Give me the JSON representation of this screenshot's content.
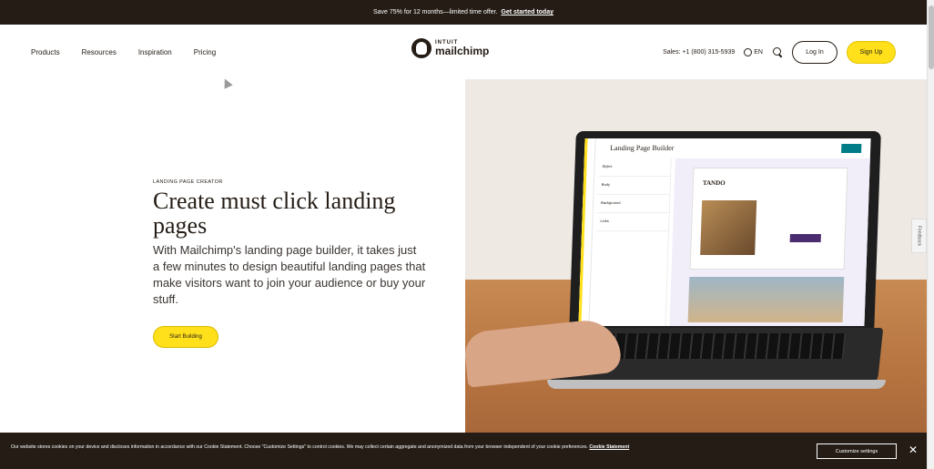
{
  "promo": {
    "text": "Save 75% for 12 months—limited time offer.",
    "link": "Get started today"
  },
  "nav": {
    "items": [
      "Products",
      "Resources",
      "Inspiration",
      "Pricing"
    ],
    "logo_top": "INTUIT",
    "logo_bottom": "mailchimp",
    "sales": "Sales: +1 (800) 315-5939",
    "locale": "EN",
    "login": "Log In",
    "signup": "Sign Up"
  },
  "hero": {
    "eyebrow": "LANDING PAGE CREATOR",
    "title": "Create must click landing pages",
    "body": "With Mailchimp's landing page builder, it takes just a few minutes to design beautiful landing pages that make visitors want to join your audience or buy your stuff.",
    "cta": "Start Building"
  },
  "mockup": {
    "builder_title": "Landing Page Builder",
    "panel_rows": [
      "Styles",
      "Body",
      "Background",
      "Links"
    ],
    "brand": "TANDO"
  },
  "feedback": {
    "label": "Feedback"
  },
  "cookie": {
    "text": "Our website stores cookies on your device and discloses information in accordance with our Cookie Statement. Choose \"Customize Settings\" to control cookies. We may collect certain aggregate and anonymized data from your browser independent of your cookie preferences.",
    "link": "Cookie Statement",
    "button": "Customize settings",
    "close": "✕"
  },
  "colors": {
    "brand_dark": "#241c15",
    "brand_yellow": "#ffe01b",
    "teal": "#007c89"
  }
}
